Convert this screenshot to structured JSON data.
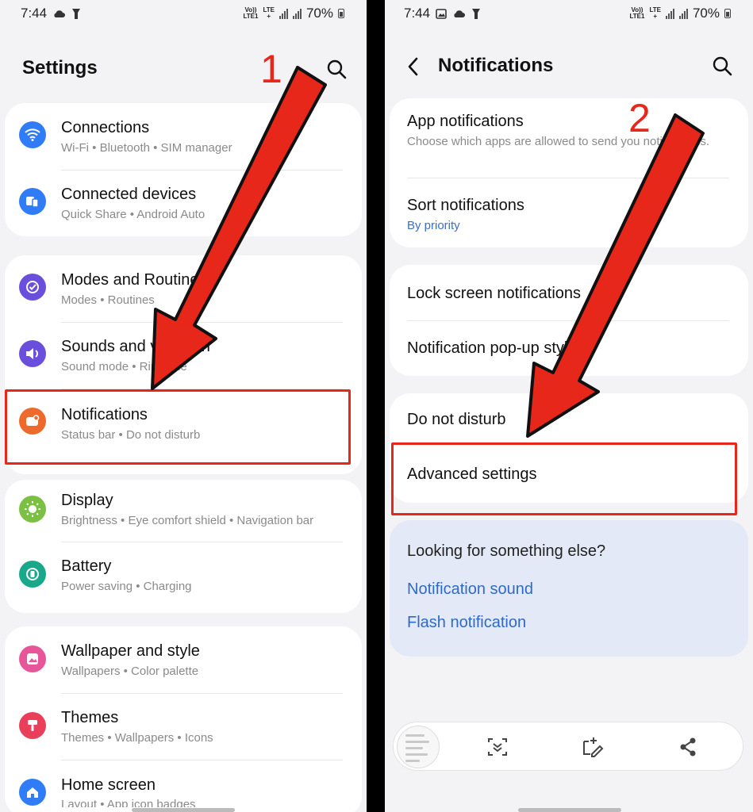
{
  "left": {
    "status": {
      "time": "7:44",
      "net_top": "Vo))",
      "net_bottom": "LTE1",
      "net2_top": "LTE",
      "net2_bottom": "+",
      "battery": "70%"
    },
    "title": "Settings",
    "step_number": "1",
    "items": [
      {
        "title": "Connections",
        "subtitle": "Wi-Fi  •  Bluetooth  •  SIM manager",
        "icon": "wifi-icon",
        "color": "#2f7cf6"
      },
      {
        "title": "Connected devices",
        "subtitle": "Quick Share  •  Android Auto",
        "icon": "connected-devices-icon",
        "color": "#2f7cf6"
      },
      {
        "title": "Modes and Routines",
        "subtitle": "Modes  •  Routines",
        "icon": "modes-icon",
        "color": "#6a4fdc"
      },
      {
        "title": "Sounds and vibration",
        "subtitle": "Sound mode  •  Ringtone",
        "icon": "sound-icon",
        "color": "#6a4fdc"
      },
      {
        "title": "Notifications",
        "subtitle": "Status bar  •  Do not disturb",
        "icon": "notifications-icon",
        "color": "#ee6a2c"
      },
      {
        "title": "Display",
        "subtitle": "Brightness  •  Eye comfort shield  •  Navigation bar",
        "icon": "display-icon",
        "color": "#7bc043"
      },
      {
        "title": "Battery",
        "subtitle": "Power saving  •  Charging",
        "icon": "battery-icon",
        "color": "#1aa88a"
      },
      {
        "title": "Wallpaper and style",
        "subtitle": "Wallpapers  •  Color palette",
        "icon": "wallpaper-icon",
        "color": "#e8569a"
      },
      {
        "title": "Themes",
        "subtitle": "Themes  •  Wallpapers  •  Icons",
        "icon": "themes-icon",
        "color": "#ea3f5a"
      },
      {
        "title": "Home screen",
        "subtitle": "Layout  •  App icon badges",
        "icon": "home-icon",
        "color": "#2f7cf6"
      }
    ]
  },
  "right": {
    "status": {
      "time": "7:44",
      "net_top": "Vo))",
      "net_bottom": "LTE1",
      "net2_top": "LTE",
      "net2_bottom": "+",
      "battery": "70%"
    },
    "title": "Notifications",
    "step_number": "2",
    "items": [
      {
        "title": "App notifications",
        "subtitle": "Choose which apps are allowed to send you notifications."
      },
      {
        "title": "Sort notifications",
        "subtitle": "By priority"
      },
      {
        "title": "Lock screen notifications"
      },
      {
        "title": "Notification pop-up style"
      },
      {
        "title": "Do not disturb"
      },
      {
        "title": "Advanced settings"
      }
    ],
    "looking": {
      "heading": "Looking for something else?",
      "links": [
        "Notification sound",
        "Flash notification"
      ]
    }
  },
  "colors": {
    "accent_red": "#e8271b",
    "link_blue": "#2f6ac8"
  }
}
